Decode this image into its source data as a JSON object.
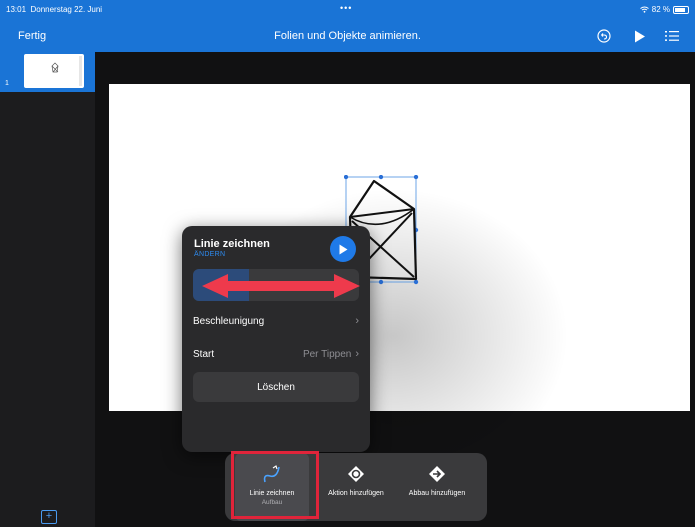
{
  "statusbar": {
    "time": "13:01",
    "date": "Donnerstag 22. Juni",
    "dots": "•••",
    "battery": "82 %"
  },
  "toolbar": {
    "done_label": "Fertig",
    "title": "Folien und Objekte animieren.",
    "icons": [
      "undo-icon",
      "play-icon",
      "list-icon"
    ]
  },
  "sidebar": {
    "slides": [
      {
        "number": "1"
      }
    ]
  },
  "popover": {
    "title": "Linie zeichnen",
    "change_label": "ÄNDERN",
    "acceleration_label": "Beschleunigung",
    "start_label": "Start",
    "start_value": "Per Tippen",
    "delete_label": "Löschen"
  },
  "anim_bar": {
    "items": [
      {
        "label": "Linie zeichnen",
        "sub": "Aufbau"
      },
      {
        "label": "Aktion hinzufügen"
      },
      {
        "label": "Abbau hinzufügen"
      }
    ]
  },
  "colors": {
    "accent_blue": "#1a74d6",
    "annotation_red": "#e0243a"
  }
}
